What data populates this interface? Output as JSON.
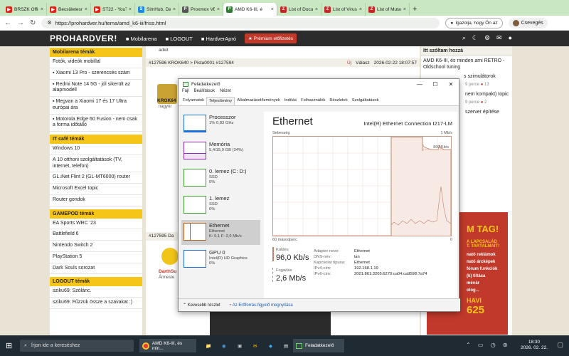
{
  "browser": {
    "tabs": [
      {
        "label": "BRSZK Official",
        "color": "#e62117"
      },
      {
        "label": "Becsületesnejl",
        "color": "#e62117"
      },
      {
        "label": "ST22 - YouTub",
        "color": "#e62117"
      },
      {
        "label": "SimHub, Dash",
        "color": "#1e88e5"
      },
      {
        "label": "Proxmox VE",
        "color": "#555555"
      },
      {
        "label": "AMD K6-III, é",
        "color": "#2e7d32",
        "active": true
      },
      {
        "label": "List of Docum",
        "color": "#c62828"
      },
      {
        "label": "List of Virus S",
        "color": "#c62828"
      },
      {
        "label": "List of Mutat",
        "color": "#c62828"
      }
    ],
    "url": "https://prohardver.hu/tema/amd_k6-iii/friss.html",
    "incognito": "Igazolja, hogy Ön az",
    "profile": "Csevegés"
  },
  "site": {
    "logo": "PROHARDVER!",
    "nav": [
      "Mobilarena",
      "LOGOUT",
      "HardverApró"
    ],
    "premium": "Prémium előfizetés"
  },
  "left": {
    "top_cut": "Mobilarena témák",
    "mob_items": [
      "Fotók, videók mobillal",
      "Xiaomi 13 Pro - szerencsés szám",
      "Redmi Note 14 5G - jól sikerült az alapmodell",
      "Megvan a Xiaomi 17 és 17 Ultra európai ára",
      "Motorola Edge 60 Fusion - nem csak a forma időtálló"
    ],
    "itcafe_head": "IT café témák",
    "itcafe_items": [
      "Windows 10",
      "A 10 otthoni szolgáltatások (TV, internet, telefon)",
      "GL.iNet Flint 2 (GL-MT6000) router",
      "Microsoft Excel topic",
      "Router gondok"
    ],
    "game_head": "GAMEPOD témák",
    "game_items": [
      "EA Sports WRC '23",
      "Battlefield 6",
      "Nintendo Switch 2",
      "PlayStation 5",
      "Dark Souls sorozat"
    ],
    "logout_head": "LOGOUT témák",
    "logout_items": [
      "sziku69: Szólánc.",
      "sziku69: Fűzzük össze a szavakat :)"
    ]
  },
  "middle": {
    "post1_cut": "adkit",
    "post1_header": "#127596 KROK640 > Pista0001 #127594",
    "post1_actions": [
      "Új",
      "Válasz"
    ],
    "post1_date": "2026-02-22 18:07:57",
    "post1_author": "KROK64",
    "post1_rank": "nagyúr",
    "post2_header": "#127595 Da",
    "post2_author": "DarthSu",
    "post2_rank": "Ármeste"
  },
  "right": {
    "head": "Itt szóltam hozzá",
    "items": [
      {
        "text": "AMD K6-III, és minden ami RETRO - Oldschool tuning"
      },
      {
        "text": "s szimulátorok"
      },
      {
        "text": "9 perce",
        "badge": "13"
      },
      {
        "text": "nem kompakt) topic"
      },
      {
        "text": "9 perce",
        "badge": "2"
      },
      {
        "text": "szerver építése"
      }
    ],
    "ad_lines": [
      "M TAG!",
      "A LAPCSALÁD",
      "T. TARTALMAIT!",
      "nató reklámok",
      "nató árcképek",
      "fórum funkciók",
      "(k) tiltása",
      "ménár",
      "olog..."
    ],
    "ad_price": "625",
    "ad_havi": "HAVI"
  },
  "taskmanager": {
    "title": "Feladatkezelő",
    "menu": [
      "Fájl",
      "Beállítások",
      "Nézet"
    ],
    "tabs": [
      "Folyamatok",
      "Teljesítmény",
      "Alkalmazáselőzmények",
      "Indítás",
      "Felhasználók",
      "Részletek",
      "Szolgáltatások"
    ],
    "resources": [
      {
        "name": "Processzor",
        "sub1": "1% 0,83 GHz",
        "sub2": "",
        "color": "#1e6fd9"
      },
      {
        "name": "Memória",
        "sub1": "5,4/15,9 GB (34%)",
        "sub2": "",
        "color": "#8b2fb8"
      },
      {
        "name": "0. lemez (C: D:)",
        "sub1": "SSD",
        "sub2": "0%",
        "color": "#3e9b2e"
      },
      {
        "name": "1. lemez",
        "sub1": "SSD",
        "sub2": "0%",
        "color": "#3e9b2e"
      },
      {
        "name": "Ethernet",
        "sub1": "Ethernet",
        "sub2": "K: 0,1 F: 2,6 Mb/s",
        "color": "#b5651d",
        "selected": true
      },
      {
        "name": "GPU 0",
        "sub1": "Intel(R) HD Graphics",
        "sub2": "0%",
        "color": "#1e6fd9"
      }
    ],
    "main_title": "Ethernet",
    "adapter": "Intel(R) Ethernet Connection I217-LM",
    "graph_caption": "Sebesség",
    "graph_max": "1 Mb/s",
    "graph_mid": "800 Kb/s",
    "graph_x_left": "60 másodperc",
    "graph_x_right": "0",
    "send_label": "Küldés",
    "send_value": "96,0 Kb/s",
    "recv_label": "Fogadás",
    "recv_value": "2,6 Mb/s",
    "details": [
      {
        "k": "Adapter neve:",
        "v": "Ethernet"
      },
      {
        "k": "DNS-név:",
        "v": "lan"
      },
      {
        "k": "Kapcsolat típusa:",
        "v": "Ethernet"
      },
      {
        "k": "IPv4-cím:",
        "v": "192.168.1.19"
      },
      {
        "k": "IPv6-cím:",
        "v": "2001:861:3205:6270:ca04:ca9598:7a74"
      }
    ],
    "footer_less": "Kevesebb részlet",
    "footer_monitor": "Az Erőforrás-figyelő megnyitása"
  },
  "taskbar": {
    "search": "Írjon ide a kereséshez",
    "app1": "AMD K6-III, és min...",
    "app2": "Feladatkezelő",
    "time": "18:30",
    "date": "2026. 02. 22."
  }
}
